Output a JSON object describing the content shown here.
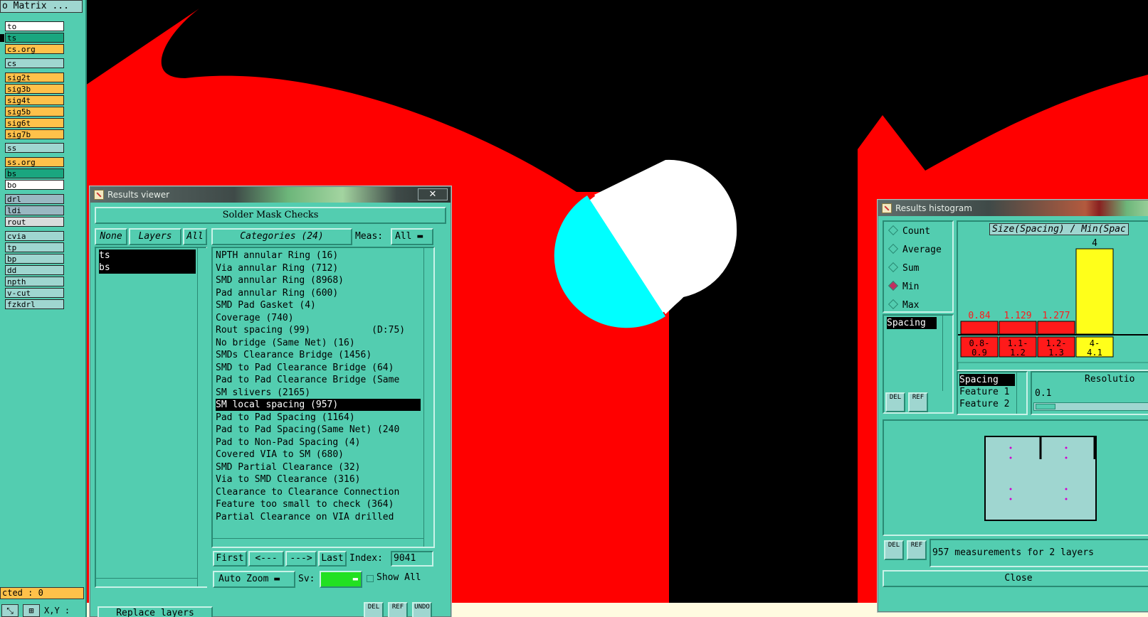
{
  "matrix": {
    "title": "o Matrix ...",
    "layers": [
      {
        "name": "to",
        "style": "white"
      },
      {
        "name": "ts",
        "style": "green"
      },
      {
        "name": "cs.org",
        "style": "orange"
      },
      {
        "name": "cs",
        "style": "cyan"
      },
      {
        "name": "sig2t",
        "style": "orange"
      },
      {
        "name": "sig3b",
        "style": "orange"
      },
      {
        "name": "sig4t",
        "style": "orange"
      },
      {
        "name": "sig5b",
        "style": "orange"
      },
      {
        "name": "sig6t",
        "style": "orange"
      },
      {
        "name": "sig7b",
        "style": "orange"
      },
      {
        "name": "ss",
        "style": "cyan"
      },
      {
        "name": "ss.org",
        "style": "orange"
      },
      {
        "name": "bs",
        "style": "green"
      },
      {
        "name": "bo",
        "style": "white"
      },
      {
        "name": "drl",
        "style": "gray"
      },
      {
        "name": "ldi",
        "style": "gray"
      },
      {
        "name": "rout",
        "style": "lgray"
      },
      {
        "name": "cvia",
        "style": "cyan"
      },
      {
        "name": "tp",
        "style": "cyan"
      },
      {
        "name": "bp",
        "style": "cyan"
      },
      {
        "name": "dd",
        "style": "cyan"
      },
      {
        "name": "npth",
        "style": "cyan"
      },
      {
        "name": "v-cut",
        "style": "cyan"
      },
      {
        "name": "fzkdrl",
        "style": "cyan"
      }
    ],
    "selected_text": "cted : 0",
    "xy_label": "X,Y :"
  },
  "results_viewer": {
    "title": "Results viewer",
    "close": "✕",
    "header": "Solder Mask Checks",
    "none_btn": "None",
    "layers_btn": "Layers",
    "all_btn": "All",
    "categories_btn": "Categories (24)",
    "meas_label": "Meas:",
    "meas_value": "All",
    "layers": [
      "ts",
      "bs"
    ],
    "categories": [
      "NPTH annular Ring (16)",
      "Via annular Ring (712)",
      "SMD annular Ring (8968)",
      "Pad annular Ring (600)",
      "SMD Pad Gasket (4)",
      "Coverage (740)",
      "Rout spacing (99)           (D:75)",
      "No bridge (Same Net) (16)",
      "SMDs Clearance Bridge (1456)",
      "SMD to Pad Clearance Bridge (64)",
      "Pad to Pad Clearance Bridge (Same",
      "SM slivers (2165)",
      "SM local spacing (957)",
      "Pad to Pad Spacing (1164)",
      "Pad to Pad Spacing(Same Net) (240",
      "Pad to Non-Pad Spacing (4)",
      "Covered VIA to SM (680)",
      "SMD Partial Clearance (32)",
      "Via to SMD Clearance (316)",
      "Clearance to Clearance Connection",
      "Feature too small to check (364)",
      "Partial Clearance on VIA drilled"
    ],
    "selected_category": "SM local spacing (957)",
    "first_btn": "First",
    "prev_btn": "<---",
    "next_btn": "--->",
    "last_btn": "Last",
    "index_label": "Index:",
    "index_value": "9041",
    "auto_zoom": "Auto Zoom",
    "sv_label": "Sv:",
    "show_all": "Show All",
    "replace_layers": "Replace layers",
    "del_label": "DEL",
    "ref_label": "REF",
    "undo_label": "UNDO"
  },
  "histogram": {
    "title": "Results histogram",
    "modes": [
      "Count",
      "Average",
      "Sum",
      "Min",
      "Max"
    ],
    "selected_mode": "Min",
    "measure_list": [
      "Spacing"
    ],
    "chart_title": "Size(Spacing) / Min(Spac",
    "bins": [
      {
        "label": "0.8- 0.9",
        "value": "0.84",
        "color": "#ff1a1a"
      },
      {
        "label": "1.1- 1.2",
        "value": "1.129",
        "color": "#ff1a1a"
      },
      {
        "label": "1.2- 1.3",
        "value": "1.277",
        "color": "#ff1a1a"
      },
      {
        "label": "4- 4.1",
        "value": "4",
        "color": "#ffff1a"
      }
    ],
    "fields": [
      "Spacing",
      "Feature 1",
      "Feature 2"
    ],
    "resolution_label": "Resolutio",
    "resolution_value": "0.1",
    "status": "957 measurements for 2 layers",
    "close_btn": "Close",
    "del_label": "DEL",
    "ref_label": "REF"
  },
  "colors": {
    "panel": "#53cdb0",
    "board_red": "#ff0000",
    "pad_cyan": "#00ffff",
    "pad_white": "#ffffff",
    "bar_red": "#ff1a1a",
    "bar_yellow": "#ffff1a"
  }
}
